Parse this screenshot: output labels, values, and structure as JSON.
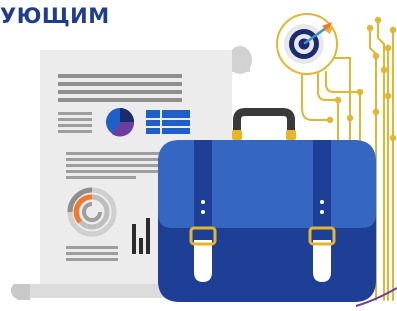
{
  "heading": {
    "text": "УЮЩИМ"
  },
  "illustration": {
    "subject": "business-briefcase-document-target",
    "colors": {
      "heading": "#1e3d8f",
      "briefcase_body": "#2d5cb3",
      "briefcase_dark": "#1e3f96",
      "briefcase_flap": "#3566c2",
      "strap": "#ffffff",
      "buckle": "#e6b52c",
      "document": "#ececec",
      "document_shadow": "#d2d2d2",
      "document_text_lines": "#888888",
      "chart_blue": "#1f5fc9",
      "chart_dark": "#1a2c6b",
      "circuit_gold": "#e6b52c",
      "target_dark": "#1a2c6b",
      "target_light": "#e8e8e8",
      "accent_orange": "#f07a2a",
      "accent_purple": "#6b3fa0"
    },
    "icons": [
      "document-icon",
      "pie-chart-icon",
      "table-icon",
      "donut-chart-icon",
      "bar-chart-icon",
      "briefcase-icon",
      "target-icon",
      "arrow-icon",
      "circuit-lines-icon"
    ]
  }
}
